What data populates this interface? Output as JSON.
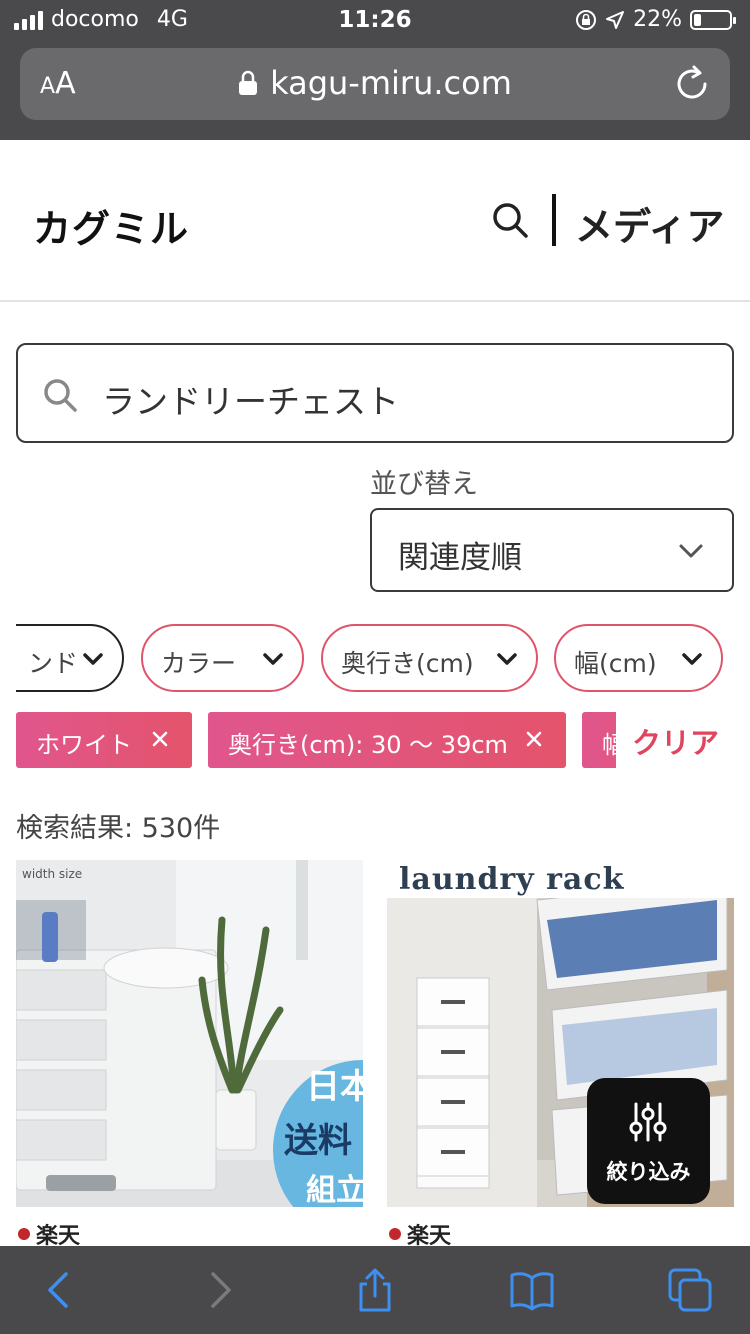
{
  "status_bar": {
    "carrier": "docomo",
    "network": "4G",
    "time": "11:26",
    "battery": "22%",
    "battery_level": 0.22
  },
  "browser": {
    "text_size_label_small": "A",
    "text_size_label_large": "A",
    "url": "kagu-miru.com"
  },
  "header": {
    "logo": "カグミル",
    "media_label": "メディア"
  },
  "search": {
    "query": "ランドリーチェスト"
  },
  "sort": {
    "label": "並び替え",
    "value": "関連度順"
  },
  "filters": [
    {
      "label": "ンド"
    },
    {
      "label": "カラー"
    },
    {
      "label": "奥行き(cm)"
    },
    {
      "label": "幅(cm)"
    }
  ],
  "selected_tags": [
    {
      "label": "ホワイト"
    },
    {
      "label": "奥行き(cm): 30 〜 39cm"
    },
    {
      "label": "幅"
    }
  ],
  "clear_label": "クリア",
  "result_count": "検索結果: 530件",
  "products": [
    {
      "source": "楽天",
      "image_text": [
        "width size",
        "日本",
        "送料",
        "組立"
      ]
    },
    {
      "source": "楽天",
      "image_text": [
        "laundry rack"
      ]
    }
  ],
  "filter_button": {
    "label": "絞り込み"
  },
  "colors": {
    "accent": "#e0546b",
    "tag_gradient_start": "#e0568d",
    "tag_gradient_end": "#e4546b",
    "browser_chrome": "#4a4a4c",
    "toolbar_icon": "#3d8ff0"
  },
  "toolbar_icons": [
    "back-icon",
    "forward-icon",
    "share-icon",
    "bookmarks-icon",
    "tabs-icon"
  ]
}
